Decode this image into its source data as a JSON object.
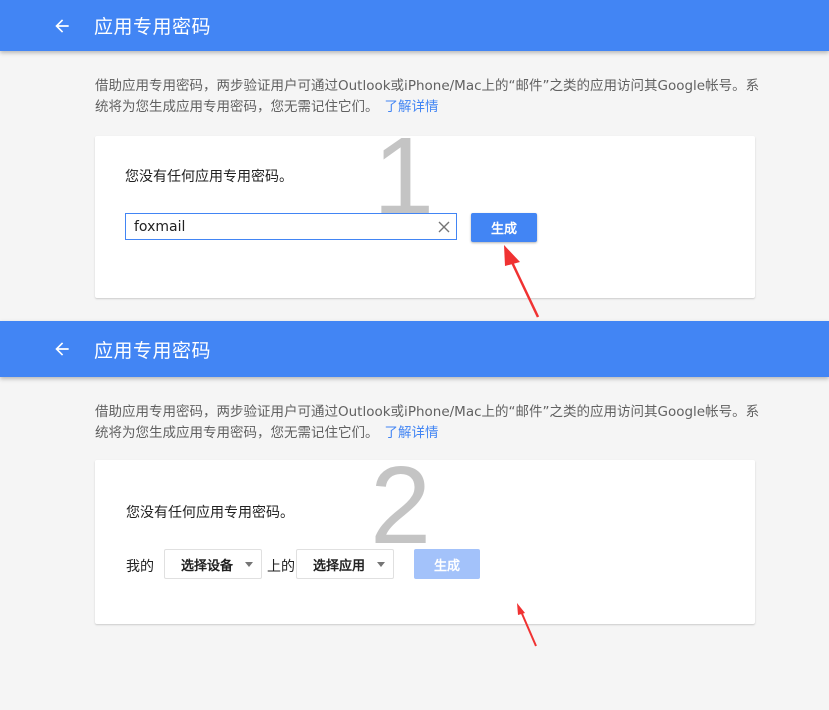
{
  "panel1": {
    "title": "应用专用密码",
    "description": "借助应用专用密码，两步验证用户可通过Outlook或iPhone/Mac上的“邮件”之类的应用访问其Google帐号。系统将为您生成应用专用密码，您无需记住它们。",
    "learn_more": "了解详情",
    "empty_text": "您没有任何应用专用密码。",
    "step_number": "1",
    "input_value": "foxmail",
    "generate_label": "生成"
  },
  "panel2": {
    "title": "应用专用密码",
    "description": "借助应用专用密码，两步验证用户可通过Outlook或iPhone/Mac上的“邮件”之类的应用访问其Google帐号。系统将为您生成应用专用密码，您无需记住它们。",
    "learn_more": "了解详情",
    "empty_text": "您没有任何应用专用密码。",
    "step_number": "2",
    "prefix_label": "我的",
    "device_select": "选择设备",
    "on_label": "上的",
    "app_select": "选择应用",
    "generate_label": "生成"
  },
  "colors": {
    "brand_blue": "#4285f4",
    "disabled_blue": "#a3c2fa",
    "annotation_red": "#f03232"
  },
  "icons": [
    "arrow-back-icon",
    "clear-icon",
    "dropdown-caret-icon",
    "red-arrow-annotation"
  ]
}
